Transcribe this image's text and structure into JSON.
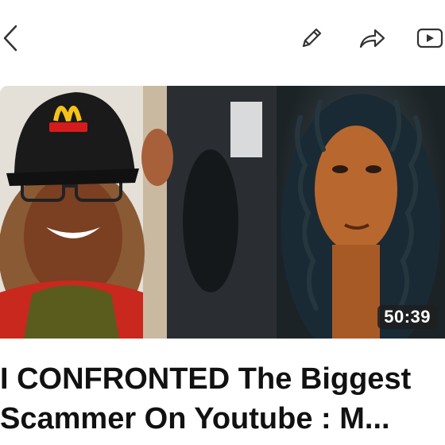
{
  "toolbar": {
    "back_icon": "chevron-left-icon",
    "edit_icon": "pencil-icon",
    "share_icon": "share-arrow-icon",
    "youtube_icon": "youtube-play-icon"
  },
  "video": {
    "duration": "50:39",
    "title_line1": "I CONFRONTED The Biggest",
    "title_line2": "Scammer On Youtube : M..."
  },
  "colors": {
    "text": "#111111",
    "icon": "#333333",
    "badge_bg": "#1e1e1e",
    "background": "#ffffff"
  }
}
